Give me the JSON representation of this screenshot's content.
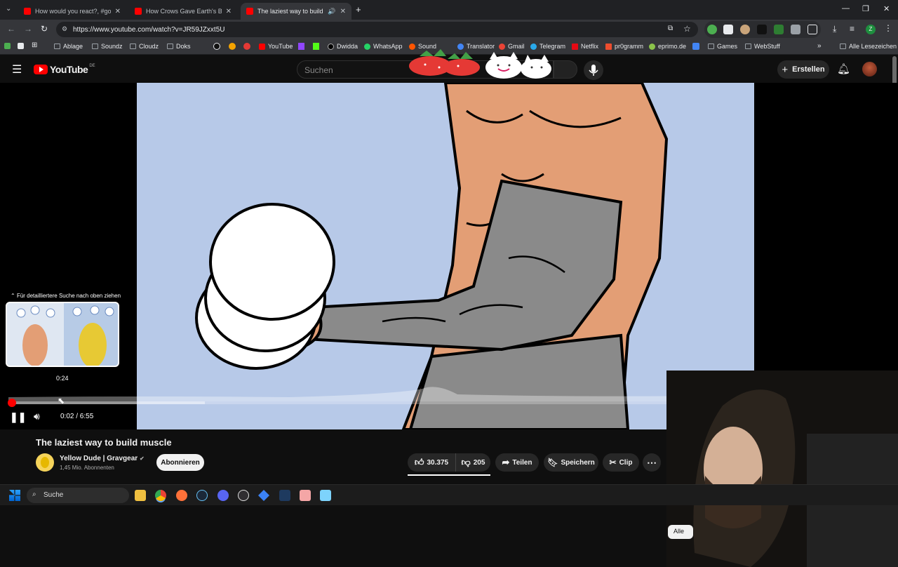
{
  "tabs": [
    {
      "title": "How would you react?, #gothg",
      "active": false
    },
    {
      "title": "How Crows Gave Earth's Bigger",
      "active": false
    },
    {
      "title": "The laziest way to build mu",
      "active": true
    }
  ],
  "omnibox": {
    "url": "https://www.youtube.com/watch?v=JR59JZxxt5U"
  },
  "bookmarks": [
    "Ablage",
    "Soundz",
    "Cloudz",
    "Doks",
    "YouTube",
    "Dwidda",
    "WhatsApp",
    "Sound",
    "Translator",
    "Gmail",
    "Telegram",
    "Netflix",
    "pr0gramm",
    "eprimo.de",
    "Games",
    "WebStuff",
    "Alle Lesezeichen"
  ],
  "youtube": {
    "logo": "YouTube",
    "region": "DE",
    "search_placeholder": "Suchen",
    "create_label": "Erstellen"
  },
  "player": {
    "preview_hint": "Für detailliertere Suche nach oben ziehen",
    "preview_time": "0:24",
    "time_display": "0:02 / 6:55",
    "played_fraction": 0.005,
    "buffered_fraction": 0.28
  },
  "video": {
    "title": "The laziest way to build muscle",
    "channel": "Yellow Dude | Gravgear",
    "subscribers": "1,45 Mio. Abonnenten",
    "subscribe_label": "Abonnieren",
    "likes": "30.375",
    "dislikes": "205",
    "share_label": "Teilen",
    "save_label": "Speichern",
    "clip_label": "Clip",
    "filter_chip": "Alle"
  },
  "taskbar": {
    "search_label": "Suche"
  },
  "colors": {
    "accent": "#ff0000",
    "background": "#0f0f0f",
    "video_bg": "#b7c9e8",
    "skin": "#e39e75",
    "sleeve": "#8a8a8a"
  }
}
